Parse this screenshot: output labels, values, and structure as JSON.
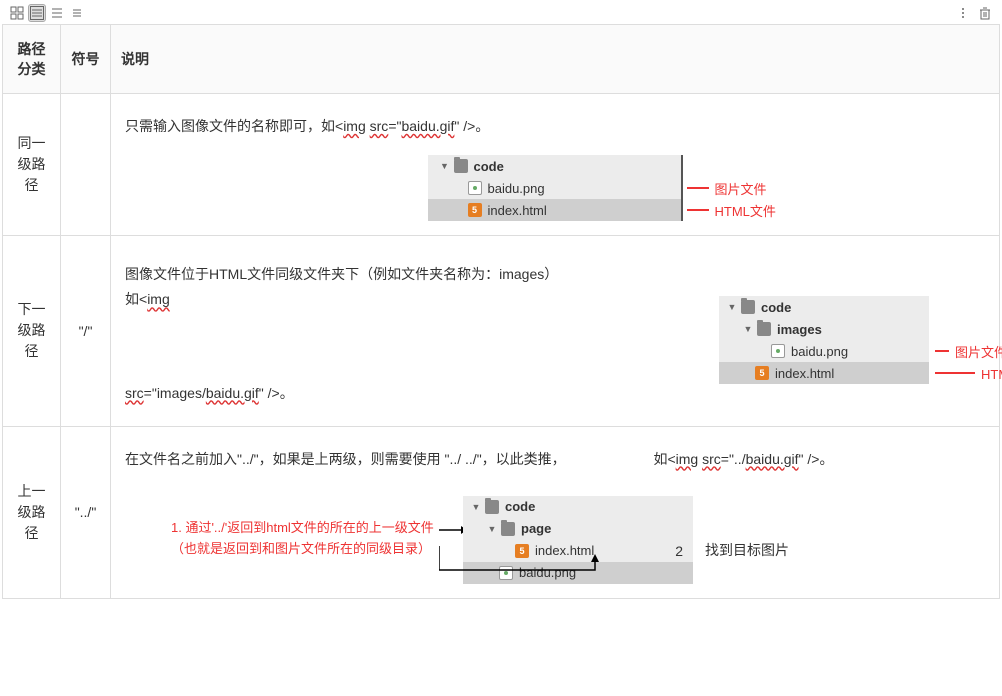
{
  "head": {
    "col1": "路径分类",
    "col2": "符号",
    "col3": "说明"
  },
  "rows": [
    {
      "category": "同一级路径",
      "symbol": "",
      "desc_prefix": "只需输入图像文件的名称即可，如<",
      "desc_tag": "img",
      "desc_mid": " ",
      "desc_attr": "src",
      "desc_eq": "=\"",
      "desc_val": "baidu.gif",
      "desc_suffix": "\" />。",
      "tree": {
        "root": "code",
        "items": [
          {
            "name": "baidu.png",
            "type": "img",
            "annot": "图片文件"
          },
          {
            "name": "index.html",
            "type": "html",
            "annot": "HTML文件",
            "selected": true
          }
        ]
      }
    },
    {
      "category": "下一级路径",
      "symbol": "\"/\"",
      "desc_line": [
        "图像文件位于HTML文件同级文件夹下（例如文件夹名称为：images）",
        "如<",
        "img"
      ],
      "desc_line2_pre": "src",
      "desc_line2_eq": "=\"images/",
      "desc_line2_val": "baidu.gif",
      "desc_line2_suf": "\" />。",
      "tree": {
        "root": "code",
        "items": [
          {
            "name": "images",
            "type": "folder",
            "bold": true
          },
          {
            "name": "baidu.png",
            "type": "img",
            "indent": 1,
            "annot": "图片文件"
          },
          {
            "name": "index.html",
            "type": "html",
            "selected": true,
            "annot": "HTML文件"
          }
        ]
      }
    },
    {
      "category": "上一级路径",
      "symbol": "\"../\"",
      "desc_line3": [
        "在文件名之前加入\"../\"，如果是上两级，则需要使用 \"../ ../\"，以此类推，",
        "如<",
        "img",
        " ",
        "src",
        "=\"../",
        "baidu.gif",
        "\" />。"
      ],
      "notes": [
        "1. 通过'../'返回到html文件的所在的上一级文件",
        "（也就是返回到和图片文件所在的同级目录）"
      ],
      "step2": "2",
      "step2_label": "找到目标图片",
      "tree": {
        "root": "code",
        "items": [
          {
            "name": "page",
            "type": "folder",
            "bold": true
          },
          {
            "name": "index.html",
            "type": "html",
            "indent": 1
          },
          {
            "name": "baidu.png",
            "type": "img",
            "selected": true
          }
        ]
      }
    }
  ]
}
